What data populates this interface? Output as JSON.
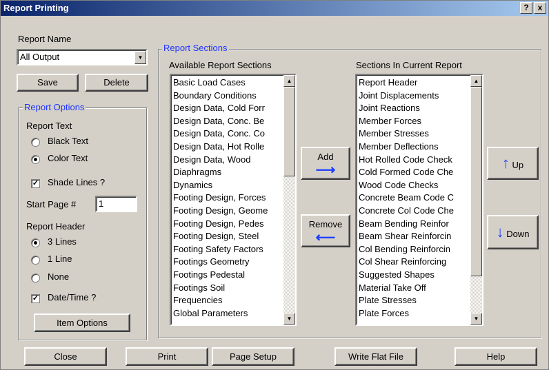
{
  "window": {
    "title": "Report Printing",
    "help_btn": "?",
    "close_btn": "x"
  },
  "report_name": {
    "label": "Report Name",
    "value": "All Output",
    "save": "Save",
    "delete": "Delete"
  },
  "report_options": {
    "title": "Report Options",
    "report_text_label": "Report Text",
    "black_text": "Black Text",
    "color_text": "Color Text",
    "selected_text": "Color Text",
    "shade_lines": "Shade Lines ?",
    "shade_lines_checked": true,
    "start_page_label": "Start Page #",
    "start_page_value": "1",
    "report_header_label": "Report Header",
    "header_3": "3 Lines",
    "header_1": "1 Line",
    "header_none": "None",
    "selected_header": "3 Lines",
    "datetime": "Date/Time ?",
    "datetime_checked": true,
    "item_options": "Item Options"
  },
  "report_sections": {
    "title": "Report Sections",
    "available_label": "Available Report Sections",
    "available": [
      "Basic Load Cases",
      "Boundary Conditions",
      "Design Data, Cold Forr",
      "Design Data, Conc. Be",
      "Design Data, Conc. Co",
      "Design Data, Hot Rolle",
      "Design Data, Wood",
      "Diaphragms",
      "Dynamics",
      "Footing Design, Forces",
      "Footing Design, Geome",
      "Footing Design, Pedes",
      "Footing Design, Steel",
      "Footing Safety Factors",
      "Footings Geometry",
      "Footings Pedestal",
      "Footings Soil",
      "Frequencies",
      "Global Parameters"
    ],
    "current_label": "Sections In Current Report",
    "current": [
      "Report Header",
      "Joint Displacements",
      "Joint Reactions",
      "Member Forces",
      "Member Stresses",
      "Member Deflections",
      "Hot Rolled Code Check",
      "Cold Formed Code Che",
      "Wood Code Checks",
      "Concrete Beam Code C",
      "Concrete Col Code Che",
      "Beam Bending Reinfor",
      "Beam Shear Reinforcin",
      "Col Bending Reinforcin",
      "Col Shear Reinforcing",
      "Suggested Shapes",
      "Material Take Off",
      "Plate Stresses",
      "Plate Forces"
    ],
    "add": "Add",
    "remove": "Remove",
    "up": "Up",
    "down": "Down"
  },
  "footer": {
    "close": "Close",
    "print": "Print",
    "page_setup": "Page Setup",
    "write_flat_file": "Write Flat File",
    "help": "Help"
  },
  "colors": {
    "titlebar_start": "#0a246a",
    "group_title": "#1f33ff",
    "arrow": "#1a3cff"
  }
}
